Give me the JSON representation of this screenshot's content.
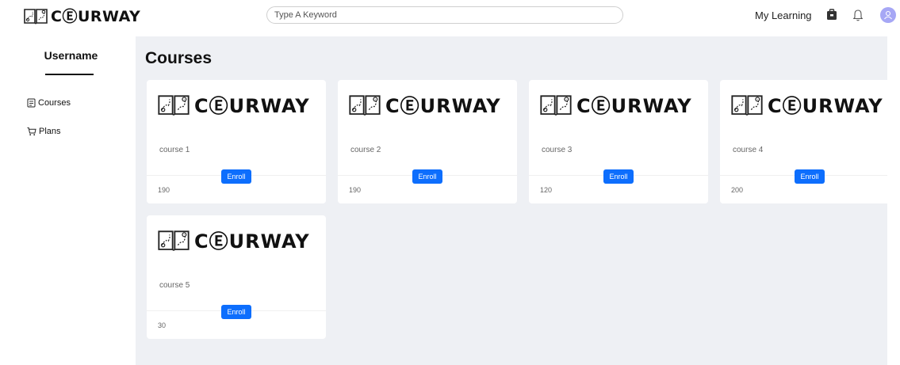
{
  "header": {
    "brand": "CⒺURWAY",
    "search_placeholder": "Type A Keyword",
    "my_learning": "My Learning",
    "icons": [
      "briefcase-icon",
      "bell-icon",
      "user-icon"
    ],
    "avatar_color": "#a6a7f5"
  },
  "sidebar": {
    "username": "Username",
    "items": [
      {
        "label": "Courses",
        "icon": "document-icon"
      },
      {
        "label": "Plans",
        "icon": "cart-icon"
      }
    ]
  },
  "main": {
    "title": "Courses",
    "background": "#eef0f4",
    "enroll_color": "#0d6efd",
    "courses": [
      {
        "logo_text": "CⒺURWAY",
        "name": "course 1",
        "enroll_label": "Enroll",
        "price": "190"
      },
      {
        "logo_text": "CⒺURWAY",
        "name": "course 2",
        "enroll_label": "Enroll",
        "price": "190"
      },
      {
        "logo_text": "CⒺURWAY",
        "name": "course 3",
        "enroll_label": "Enroll",
        "price": "120"
      },
      {
        "logo_text": "CⒺURWAY",
        "name": "course 4",
        "enroll_label": "Enroll",
        "price": "200"
      },
      {
        "logo_text": "CⒺURWAY",
        "name": "course 5",
        "enroll_label": "Enroll",
        "price": "30"
      }
    ]
  }
}
